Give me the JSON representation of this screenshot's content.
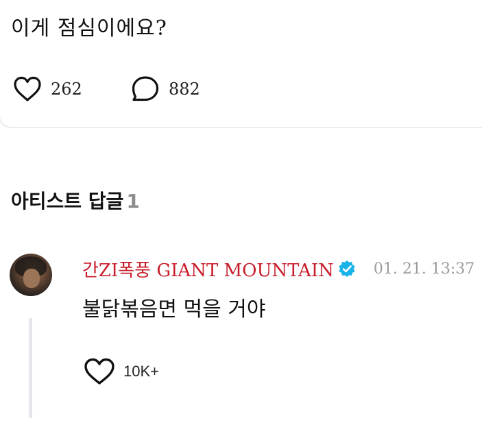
{
  "post": {
    "text": "이게 점심이에요?",
    "like_count": "262",
    "comment_count": "882"
  },
  "icons": {
    "like": "heart-outline-icon",
    "comment": "speech-bubble-outline-icon",
    "verified": "verified-badge-icon",
    "reply_like": "heart-outline-icon"
  },
  "artist_replies": {
    "title": "아티스트 답글",
    "count": "1",
    "items": [
      {
        "author": "간ZI폭풍 GIANT MOUNTAIN",
        "author_color": "#c81e2b",
        "verified": true,
        "verified_color": "#1ab3e8",
        "date": "01. 21. 13:37",
        "text": "불닭볶음면 먹을 거야",
        "like_count": "10K+"
      }
    ]
  }
}
